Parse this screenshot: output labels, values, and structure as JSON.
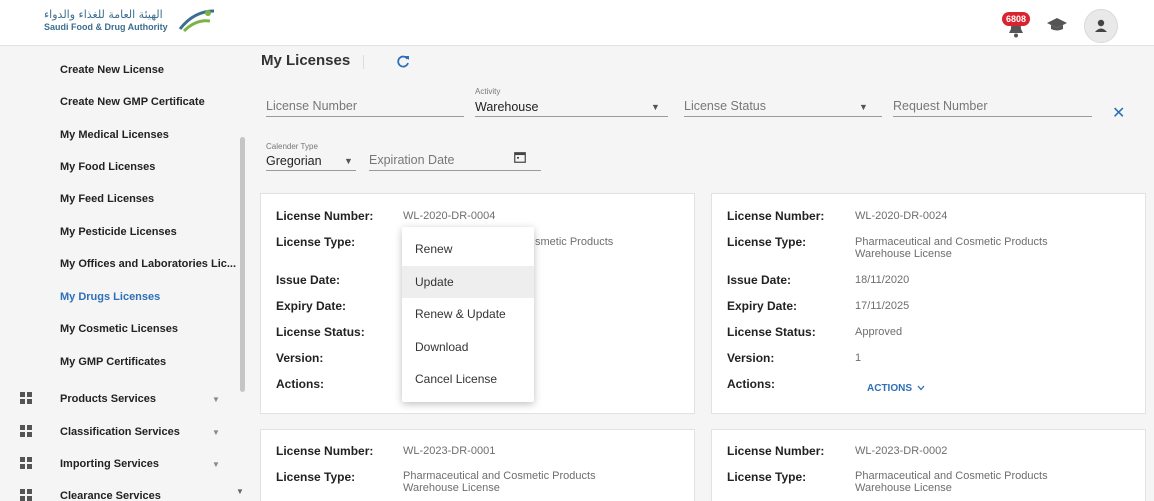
{
  "header": {
    "logo_ar": "الهيئة العامة للغذاء والدواء",
    "logo_en": "Saudi Food & Drug Authority",
    "notification_count": "6808"
  },
  "sidebar": {
    "items": [
      {
        "label": "Create New License"
      },
      {
        "label": "Create New GMP Certificate"
      },
      {
        "label": "My Medical Licenses"
      },
      {
        "label": "My Food Licenses"
      },
      {
        "label": "My Feed Licenses"
      },
      {
        "label": "My Pesticide Licenses"
      },
      {
        "label": "My Offices and Laboratories Lic..."
      },
      {
        "label": "My Drugs Licenses"
      },
      {
        "label": "My Cosmetic Licenses"
      },
      {
        "label": "My GMP Certificates"
      }
    ],
    "sections": [
      {
        "label": "Products Services"
      },
      {
        "label": "Classification Services"
      },
      {
        "label": "Importing Services"
      },
      {
        "label": "Clearance Services"
      }
    ]
  },
  "main": {
    "title": "My Licenses",
    "filters": {
      "license_number_placeholder": "License Number",
      "activity_label": "Activity",
      "activity_value": "Warehouse",
      "license_status_placeholder": "License Status",
      "request_number_placeholder": "Request Number",
      "calendar_type_label": "Calender Type",
      "calendar_type_value": "Gregorian",
      "expiration_date_placeholder": "Expiration Date"
    }
  },
  "labels": {
    "license_number": "License Number:",
    "license_type": "License Type:",
    "issue_date": "Issue Date:",
    "expiry_date": "Expiry Date:",
    "license_status": "License Status:",
    "version": "Version:",
    "actions": "Actions:",
    "actions_link": "ACTIONS"
  },
  "cards": [
    {
      "license_number": "WL-2020-DR-0004",
      "license_type_partial": "smetic Products"
    },
    {
      "license_number": "WL-2020-DR-0024",
      "license_type_line1": "Pharmaceutical and Cosmetic Products",
      "license_type_line2": "Warehouse License",
      "issue_date": "18/11/2020",
      "expiry_date": "17/11/2025",
      "license_status": "Approved",
      "version": "1"
    },
    {
      "license_number": "WL-2023-DR-0001",
      "license_type_line1": "Pharmaceutical and Cosmetic Products",
      "license_type_line2": "Warehouse License"
    },
    {
      "license_number": "WL-2023-DR-0002",
      "license_type_line1": "Pharmaceutical and Cosmetic Products",
      "license_type_line2": "Warehouse License"
    }
  ],
  "menu": {
    "items": [
      {
        "label": "Renew"
      },
      {
        "label": "Update"
      },
      {
        "label": "Renew & Update"
      },
      {
        "label": "Download"
      },
      {
        "label": "Cancel License"
      }
    ]
  },
  "colors": {
    "accent": "#2d6fb8",
    "badge": "#d9232e"
  }
}
